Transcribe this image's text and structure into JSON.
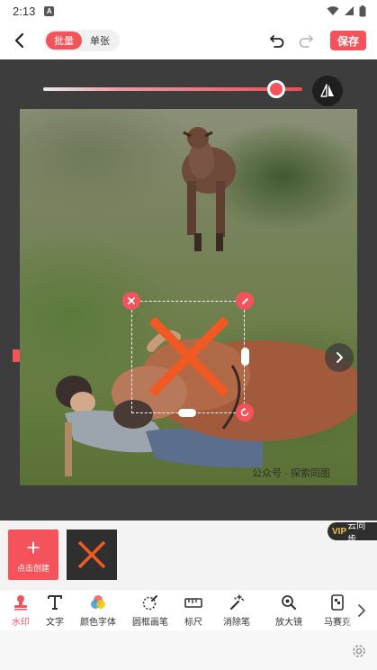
{
  "status_bar": {
    "time": "2:13",
    "notification_icon": "A"
  },
  "header": {
    "modes": [
      {
        "label": "批量",
        "active": true
      },
      {
        "label": "单张",
        "active": false
      }
    ],
    "save_label": "保存"
  },
  "editor": {
    "opacity_level": 0.9,
    "photo_watermark_text": "公众号 · 探索同图"
  },
  "watermark_strip": {
    "create_label": "点击创建",
    "vip_label": "VIP",
    "sync_label": "云同步"
  },
  "toolbar": {
    "items": [
      {
        "label": "水印",
        "icon": "stamp-icon",
        "active": true
      },
      {
        "label": "文字",
        "icon": "text-icon",
        "active": false
      },
      {
        "label": "颜色字体",
        "icon": "color-font-icon",
        "active": false
      },
      {
        "label": "圆框画笔",
        "icon": "circle-brush-icon",
        "active": false
      },
      {
        "label": "标尺",
        "icon": "ruler-icon",
        "active": false
      },
      {
        "label": "消除笔",
        "icon": "eraser-wand-icon",
        "active": false
      },
      {
        "label": "放大镜",
        "icon": "magnifier-icon",
        "active": false
      },
      {
        "label": "马赛克",
        "icon": "mosaic-icon",
        "active": false
      }
    ]
  },
  "colors": {
    "accent": "#f4535c",
    "canvas_bg": "#3d3d3d"
  }
}
